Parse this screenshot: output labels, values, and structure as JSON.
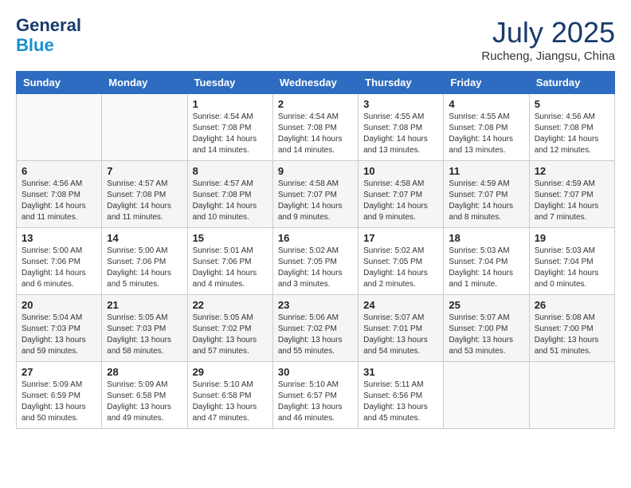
{
  "header": {
    "logo_line1": "General",
    "logo_line2": "Blue",
    "month_year": "July 2025",
    "location": "Rucheng, Jiangsu, China"
  },
  "days_of_week": [
    "Sunday",
    "Monday",
    "Tuesday",
    "Wednesday",
    "Thursday",
    "Friday",
    "Saturday"
  ],
  "weeks": [
    [
      {
        "day": "",
        "info": ""
      },
      {
        "day": "",
        "info": ""
      },
      {
        "day": "1",
        "info": "Sunrise: 4:54 AM\nSunset: 7:08 PM\nDaylight: 14 hours and 14 minutes."
      },
      {
        "day": "2",
        "info": "Sunrise: 4:54 AM\nSunset: 7:08 PM\nDaylight: 14 hours and 14 minutes."
      },
      {
        "day": "3",
        "info": "Sunrise: 4:55 AM\nSunset: 7:08 PM\nDaylight: 14 hours and 13 minutes."
      },
      {
        "day": "4",
        "info": "Sunrise: 4:55 AM\nSunset: 7:08 PM\nDaylight: 14 hours and 13 minutes."
      },
      {
        "day": "5",
        "info": "Sunrise: 4:56 AM\nSunset: 7:08 PM\nDaylight: 14 hours and 12 minutes."
      }
    ],
    [
      {
        "day": "6",
        "info": "Sunrise: 4:56 AM\nSunset: 7:08 PM\nDaylight: 14 hours and 11 minutes."
      },
      {
        "day": "7",
        "info": "Sunrise: 4:57 AM\nSunset: 7:08 PM\nDaylight: 14 hours and 11 minutes."
      },
      {
        "day": "8",
        "info": "Sunrise: 4:57 AM\nSunset: 7:08 PM\nDaylight: 14 hours and 10 minutes."
      },
      {
        "day": "9",
        "info": "Sunrise: 4:58 AM\nSunset: 7:07 PM\nDaylight: 14 hours and 9 minutes."
      },
      {
        "day": "10",
        "info": "Sunrise: 4:58 AM\nSunset: 7:07 PM\nDaylight: 14 hours and 9 minutes."
      },
      {
        "day": "11",
        "info": "Sunrise: 4:59 AM\nSunset: 7:07 PM\nDaylight: 14 hours and 8 minutes."
      },
      {
        "day": "12",
        "info": "Sunrise: 4:59 AM\nSunset: 7:07 PM\nDaylight: 14 hours and 7 minutes."
      }
    ],
    [
      {
        "day": "13",
        "info": "Sunrise: 5:00 AM\nSunset: 7:06 PM\nDaylight: 14 hours and 6 minutes."
      },
      {
        "day": "14",
        "info": "Sunrise: 5:00 AM\nSunset: 7:06 PM\nDaylight: 14 hours and 5 minutes."
      },
      {
        "day": "15",
        "info": "Sunrise: 5:01 AM\nSunset: 7:06 PM\nDaylight: 14 hours and 4 minutes."
      },
      {
        "day": "16",
        "info": "Sunrise: 5:02 AM\nSunset: 7:05 PM\nDaylight: 14 hours and 3 minutes."
      },
      {
        "day": "17",
        "info": "Sunrise: 5:02 AM\nSunset: 7:05 PM\nDaylight: 14 hours and 2 minutes."
      },
      {
        "day": "18",
        "info": "Sunrise: 5:03 AM\nSunset: 7:04 PM\nDaylight: 14 hours and 1 minute."
      },
      {
        "day": "19",
        "info": "Sunrise: 5:03 AM\nSunset: 7:04 PM\nDaylight: 14 hours and 0 minutes."
      }
    ],
    [
      {
        "day": "20",
        "info": "Sunrise: 5:04 AM\nSunset: 7:03 PM\nDaylight: 13 hours and 59 minutes."
      },
      {
        "day": "21",
        "info": "Sunrise: 5:05 AM\nSunset: 7:03 PM\nDaylight: 13 hours and 58 minutes."
      },
      {
        "day": "22",
        "info": "Sunrise: 5:05 AM\nSunset: 7:02 PM\nDaylight: 13 hours and 57 minutes."
      },
      {
        "day": "23",
        "info": "Sunrise: 5:06 AM\nSunset: 7:02 PM\nDaylight: 13 hours and 55 minutes."
      },
      {
        "day": "24",
        "info": "Sunrise: 5:07 AM\nSunset: 7:01 PM\nDaylight: 13 hours and 54 minutes."
      },
      {
        "day": "25",
        "info": "Sunrise: 5:07 AM\nSunset: 7:00 PM\nDaylight: 13 hours and 53 minutes."
      },
      {
        "day": "26",
        "info": "Sunrise: 5:08 AM\nSunset: 7:00 PM\nDaylight: 13 hours and 51 minutes."
      }
    ],
    [
      {
        "day": "27",
        "info": "Sunrise: 5:09 AM\nSunset: 6:59 PM\nDaylight: 13 hours and 50 minutes."
      },
      {
        "day": "28",
        "info": "Sunrise: 5:09 AM\nSunset: 6:58 PM\nDaylight: 13 hours and 49 minutes."
      },
      {
        "day": "29",
        "info": "Sunrise: 5:10 AM\nSunset: 6:58 PM\nDaylight: 13 hours and 47 minutes."
      },
      {
        "day": "30",
        "info": "Sunrise: 5:10 AM\nSunset: 6:57 PM\nDaylight: 13 hours and 46 minutes."
      },
      {
        "day": "31",
        "info": "Sunrise: 5:11 AM\nSunset: 6:56 PM\nDaylight: 13 hours and 45 minutes."
      },
      {
        "day": "",
        "info": ""
      },
      {
        "day": "",
        "info": ""
      }
    ]
  ]
}
